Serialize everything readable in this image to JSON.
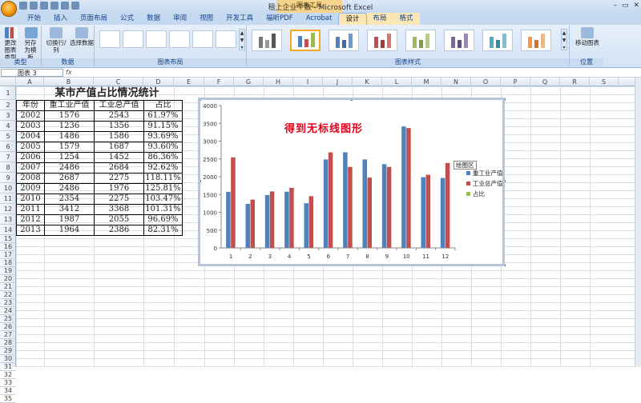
{
  "window": {
    "title": "租上企业个数 - Microsoft Excel",
    "context_group": "图表工具",
    "controls": [
      "–",
      "▭",
      "✕"
    ]
  },
  "qat": [
    "save",
    "undo",
    "redo",
    "print",
    "preview",
    "zoom"
  ],
  "tabs": [
    {
      "label": "开始"
    },
    {
      "label": "插入"
    },
    {
      "label": "页面布局"
    },
    {
      "label": "公式"
    },
    {
      "label": "数据"
    },
    {
      "label": "审阅"
    },
    {
      "label": "视图"
    },
    {
      "label": "开发工具"
    },
    {
      "label": "福昕PDF"
    },
    {
      "label": "Acrobat"
    },
    {
      "label": "设计"
    },
    {
      "label": "布局"
    },
    {
      "label": "格式"
    }
  ],
  "active_tab": "设计",
  "ribbon": {
    "groups": {
      "type": "类型",
      "data": "数据",
      "layout": "图表布局",
      "styles": "图表样式",
      "location": "位置"
    },
    "buttons": {
      "change_type": "更改图表类型",
      "save_template": "另存为模板",
      "switch_row_col": "切换行/列",
      "select_data": "选择数据",
      "move_chart": "移动图表"
    }
  },
  "formula_bar": {
    "name_box": "图表 3",
    "fx": "fx",
    "value": ""
  },
  "columns": [
    "A",
    "B",
    "C",
    "D",
    "E",
    "F",
    "G",
    "H",
    "I",
    "J",
    "K",
    "L",
    "M",
    "N",
    "O",
    "P",
    "Q",
    "R",
    "S"
  ],
  "rows": [
    "1",
    "2",
    "3",
    "4",
    "5",
    "6",
    "7",
    "8",
    "9",
    "10",
    "11",
    "12",
    "13",
    "14",
    "15",
    "16",
    "17",
    "18",
    "19",
    "20",
    "21",
    "22",
    "23",
    "24",
    "25",
    "26",
    "27",
    "28",
    "29",
    "30",
    "31",
    "32",
    "33",
    "34",
    "35"
  ],
  "table": {
    "title": "某市产值占比情况统计",
    "headers": [
      "年份",
      "重工业产值",
      "工业总产值",
      "占比"
    ],
    "rows": [
      [
        "2002",
        "1576",
        "2543",
        "61.97%"
      ],
      [
        "2003",
        "1236",
        "1356",
        "91.15%"
      ],
      [
        "2004",
        "1486",
        "1586",
        "93.69%"
      ],
      [
        "2005",
        "1579",
        "1687",
        "93.60%"
      ],
      [
        "2006",
        "1254",
        "1452",
        "86.36%"
      ],
      [
        "2007",
        "2486",
        "2684",
        "92.62%"
      ],
      [
        "2008",
        "2687",
        "2275",
        "118.11%"
      ],
      [
        "2009",
        "2486",
        "1976",
        "125.81%"
      ],
      [
        "2010",
        "2354",
        "2275",
        "103.47%"
      ],
      [
        "2011",
        "3412",
        "3368",
        "101.31%"
      ],
      [
        "2012",
        "1987",
        "2055",
        "96.69%"
      ],
      [
        "2013",
        "1964",
        "2386",
        "82.31%"
      ]
    ]
  },
  "chart_data": {
    "type": "bar",
    "title": "得到无标线图形",
    "categories": [
      "1",
      "2",
      "3",
      "4",
      "5",
      "6",
      "7",
      "8",
      "9",
      "10",
      "11",
      "12"
    ],
    "series": [
      {
        "name": "重工业产值",
        "color": "#4f81bd",
        "values": [
          1576,
          1236,
          1486,
          1579,
          1254,
          2486,
          2687,
          2486,
          2354,
          3412,
          1987,
          1964
        ]
      },
      {
        "name": "工业总产值",
        "color": "#c0504d",
        "values": [
          2543,
          1356,
          1586,
          1687,
          1452,
          2684,
          2275,
          1976,
          2275,
          3368,
          2055,
          2386
        ]
      },
      {
        "name": "占比",
        "color": "#9bbb59",
        "values": [
          0.62,
          0.91,
          0.94,
          0.94,
          0.86,
          0.93,
          1.18,
          1.26,
          1.03,
          1.01,
          0.97,
          0.82
        ]
      }
    ],
    "yticks": [
      "0",
      "500",
      "1000",
      "1500",
      "2000",
      "2500",
      "3000",
      "3500",
      "4000"
    ],
    "ylim": [
      0,
      4000
    ],
    "legend": "right",
    "tooltip": "绘图区"
  }
}
